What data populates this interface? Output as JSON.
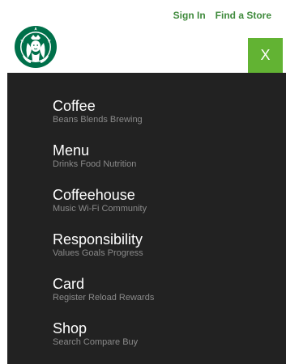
{
  "header": {
    "sign_in": "Sign In",
    "find_store": "Find a Store",
    "logo_icon": "starbucks-siren-logo-icon",
    "close_label": "X",
    "colors": {
      "link": "#3f8a3c",
      "close_bg": "#62b333",
      "logo": "#00704a"
    }
  },
  "menu": {
    "background": "#222222",
    "items": [
      {
        "title": "Coffee",
        "subtitle": "Beans Blends Brewing"
      },
      {
        "title": "Menu",
        "subtitle": "Drinks Food Nutrition"
      },
      {
        "title": "Coffeehouse",
        "subtitle": "Music Wi-Fi Community"
      },
      {
        "title": "Responsibility",
        "subtitle": "Values Goals Progress"
      },
      {
        "title": "Card",
        "subtitle": "Register Reload Rewards"
      },
      {
        "title": "Shop",
        "subtitle": "Search Compare Buy"
      }
    ]
  }
}
